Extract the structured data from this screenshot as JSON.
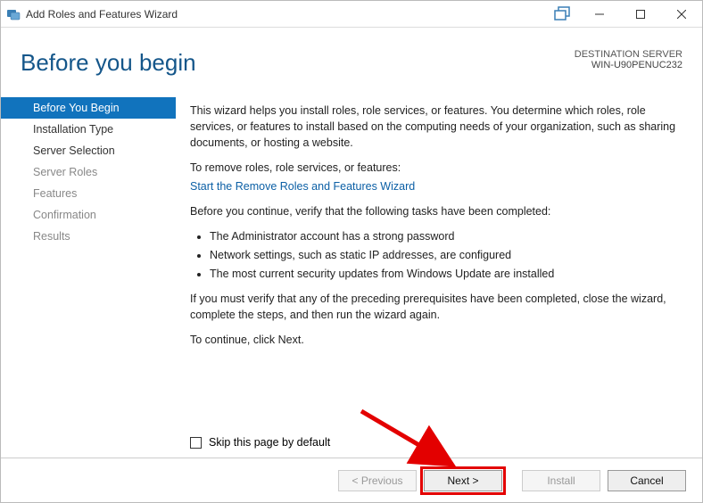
{
  "window": {
    "title": "Add Roles and Features Wizard"
  },
  "header": {
    "page_title": "Before you begin",
    "dest_label": "DESTINATION SERVER",
    "dest_name": "WIN-U90PENUC232"
  },
  "sidebar": {
    "items": [
      {
        "label": "Before You Begin",
        "selected": true,
        "enabled": true
      },
      {
        "label": "Installation Type",
        "selected": false,
        "enabled": true
      },
      {
        "label": "Server Selection",
        "selected": false,
        "enabled": true
      },
      {
        "label": "Server Roles",
        "selected": false,
        "enabled": false
      },
      {
        "label": "Features",
        "selected": false,
        "enabled": false
      },
      {
        "label": "Confirmation",
        "selected": false,
        "enabled": false
      },
      {
        "label": "Results",
        "selected": false,
        "enabled": false
      }
    ]
  },
  "main": {
    "intro": "This wizard helps you install roles, role services, or features. You determine which roles, role services, or features to install based on the computing needs of your organization, such as sharing documents, or hosting a website.",
    "remove_label": "To remove roles, role services, or features:",
    "remove_link": "Start the Remove Roles and Features Wizard",
    "verify_label": "Before you continue, verify that the following tasks have been completed:",
    "bullets": [
      "The Administrator account has a strong password",
      "Network settings, such as static IP addresses, are configured",
      "The most current security updates from Windows Update are installed"
    ],
    "prereq_note": "If you must verify that any of the preceding prerequisites have been completed, close the wizard, complete the steps, and then run the wizard again.",
    "continue_note": "To continue, click Next.",
    "skip_label": "Skip this page by default"
  },
  "footer": {
    "previous": "< Previous",
    "next": "Next >",
    "install": "Install",
    "cancel": "Cancel"
  }
}
